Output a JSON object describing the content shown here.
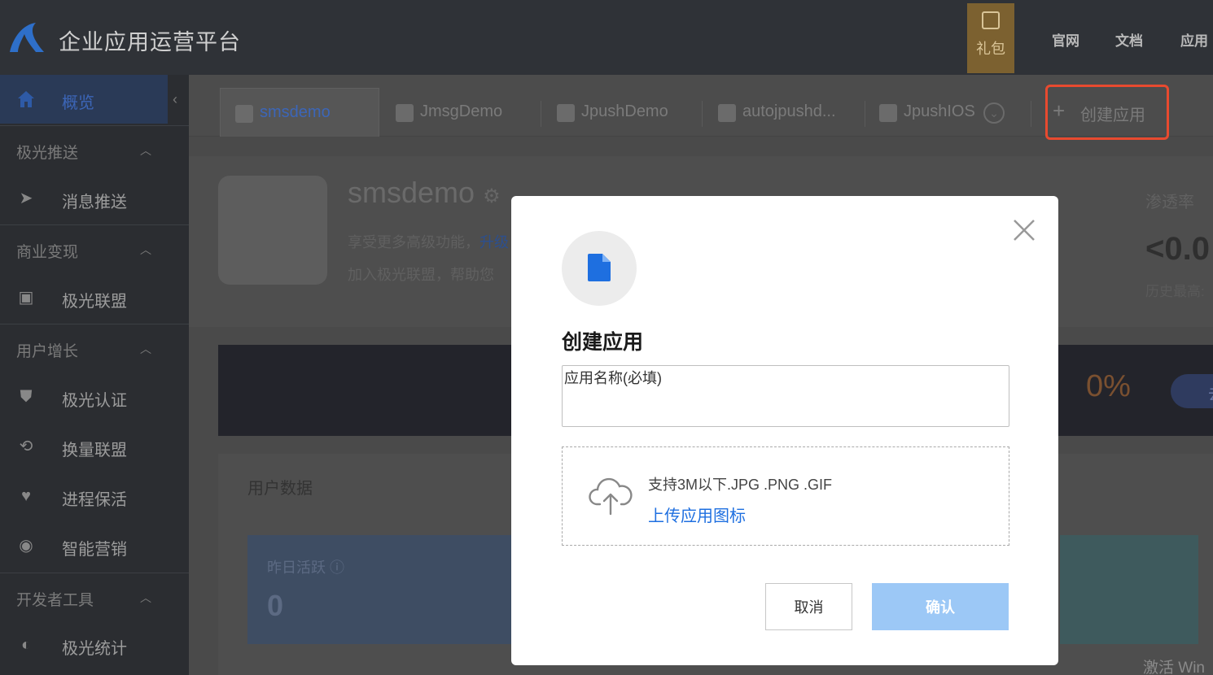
{
  "header": {
    "title": "企业应用运营平台",
    "gift_label": "礼包",
    "nav_links": [
      "官网",
      "文档",
      "应用"
    ]
  },
  "sidebar": {
    "overview": "概览",
    "sections": [
      {
        "label": "极光推送",
        "items": [
          {
            "label": "消息推送",
            "icon": "send-icon"
          }
        ]
      },
      {
        "label": "商业变现",
        "items": [
          {
            "label": "极光联盟",
            "icon": "wallet-icon"
          }
        ]
      },
      {
        "label": "用户增长",
        "items": [
          {
            "label": "极光认证",
            "icon": "shield-icon"
          },
          {
            "label": "换量联盟",
            "icon": "swap-icon"
          },
          {
            "label": "进程保活",
            "icon": "heartbeat-icon"
          },
          {
            "label": "智能营销",
            "icon": "target-icon"
          }
        ]
      },
      {
        "label": "开发者工具",
        "items": [
          {
            "label": "极光统计",
            "icon": "chart-pie-icon"
          }
        ]
      }
    ]
  },
  "tabs": [
    "smsdemo",
    "JmsgDemo",
    "JpushDemo",
    "autojpushd...",
    "JpushIOS"
  ],
  "create_app_label": "创建应用",
  "app": {
    "name": "smsdemo",
    "desc1_prefix": "享受更多高级功能，",
    "desc1_link": "升级",
    "desc2": "加入极光联盟，帮助您",
    "stat_label": "渗透率",
    "stat_value": "<0.0",
    "stat_history": "历史最高:"
  },
  "banner": {
    "percent": "0%",
    "button": "去"
  },
  "user_data": {
    "title": "用户数据",
    "yesterday_active_label": "昨日活跃",
    "yesterday_active_value": "0"
  },
  "watermark": "激活 Win",
  "modal": {
    "title": "创建应用",
    "name_placeholder": "应用名称(必填)",
    "upload_hint": "支持3M以下.JPG .PNG .GIF",
    "upload_link": "上传应用图标",
    "cancel": "取消",
    "confirm": "确认"
  },
  "colors": {
    "accent_blue": "#1e6fe0",
    "highlight_red": "#e84a2f",
    "confirm_disabled": "#9cc8f6"
  }
}
